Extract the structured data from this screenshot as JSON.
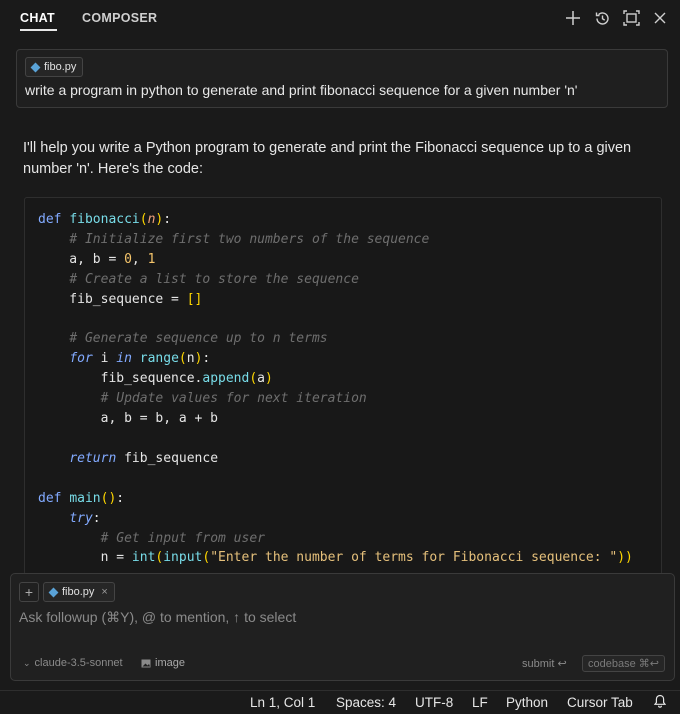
{
  "header": {
    "tabs": [
      {
        "label": "CHAT",
        "active": true
      },
      {
        "label": "COMPOSER",
        "active": false
      }
    ],
    "icons": [
      "plus-icon",
      "history-icon",
      "maximize-icon",
      "close-icon"
    ]
  },
  "user_message": {
    "file_chip": "fibo.py",
    "text": "write a program in python to generate and print fibonacci sequence for a given number 'n'"
  },
  "assistant_message": {
    "text": "I'll help you write a Python program to generate and print the Fibonacci sequence up to a given number 'n'. Here's the code:"
  },
  "code_block": {
    "language": "python",
    "lines": [
      "def fibonacci(n):",
      "    # Initialize first two numbers of the sequence",
      "    a, b = 0, 1",
      "    # Create a list to store the sequence",
      "    fib_sequence = []",
      "",
      "    # Generate sequence up to n terms",
      "    for i in range(n):",
      "        fib_sequence.append(a)",
      "        # Update values for next iteration",
      "        a, b = b, a + b",
      "",
      "    return fib_sequence",
      "",
      "def main():",
      "    try:",
      "        # Get input from user",
      "        n = int(input(\"Enter the number of terms for Fibonacci sequence: \"))"
    ]
  },
  "composer": {
    "file_chip": "fibo.py",
    "placeholder": "Ask followup (⌘Y), @ to mention, ↑ to select",
    "model": "claude-3.5-sonnet",
    "image_label": "image",
    "submit_label": "submit ↩",
    "codebase_label": "codebase ⌘↩"
  },
  "status_bar": {
    "position": "Ln 1, Col 1",
    "spaces": "Spaces: 4",
    "encoding": "UTF-8",
    "eol": "LF",
    "language": "Python",
    "cursor_tab": "Cursor Tab"
  },
  "colors": {
    "background": "#1a1a1a",
    "keyword": "#82aaff",
    "function": "#78dce8",
    "number": "#f5c56b",
    "comment": "#6e6e6e"
  }
}
